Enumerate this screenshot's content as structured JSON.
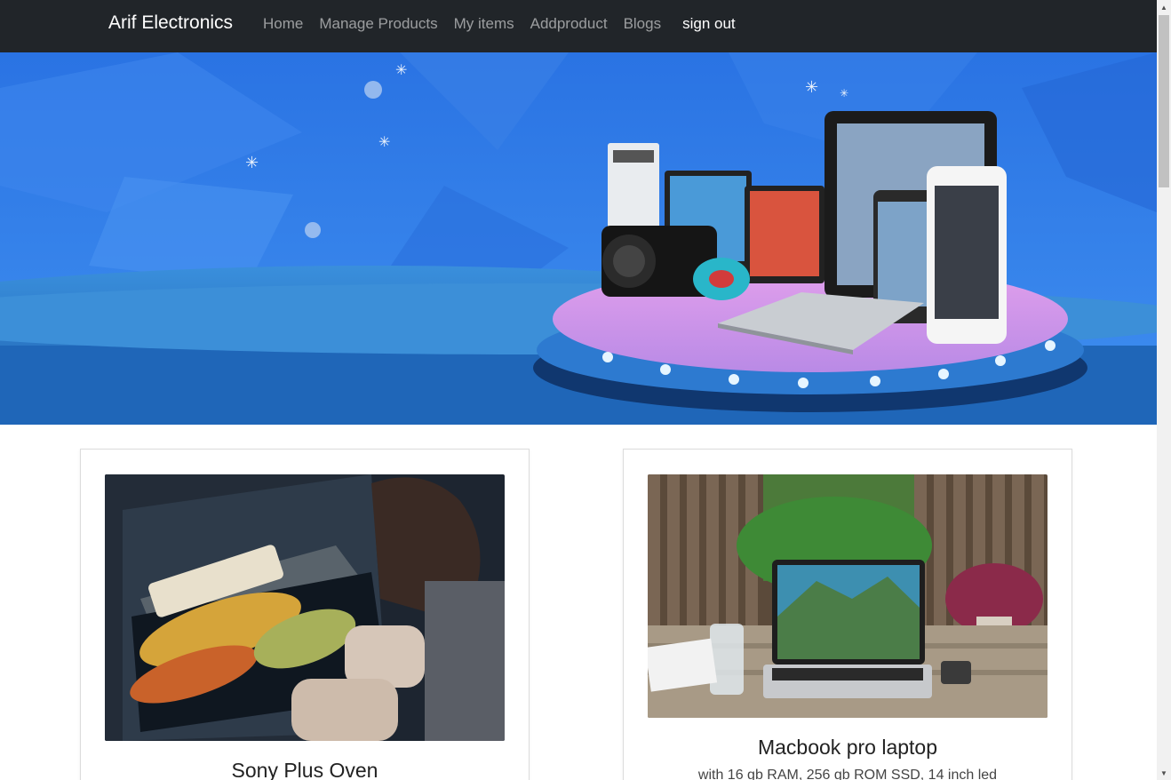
{
  "navbar": {
    "brand": "Arif Electronics",
    "links": [
      "Home",
      "Manage Products",
      "My items",
      "Addproduct",
      "Blogs"
    ],
    "signout": "sign out"
  },
  "banner": {
    "icon": "electronics-banner-image"
  },
  "products": [
    {
      "title": "Sony Plus Oven",
      "description": "",
      "image": "oven-photo"
    },
    {
      "title": "Macbook pro laptop",
      "description": "with 16 gb RAM, 256 gb ROM SSD, 14 inch led",
      "image": "laptop-photo"
    }
  ],
  "colors": {
    "navbar": "#212529",
    "banner": "#2f7be8"
  }
}
